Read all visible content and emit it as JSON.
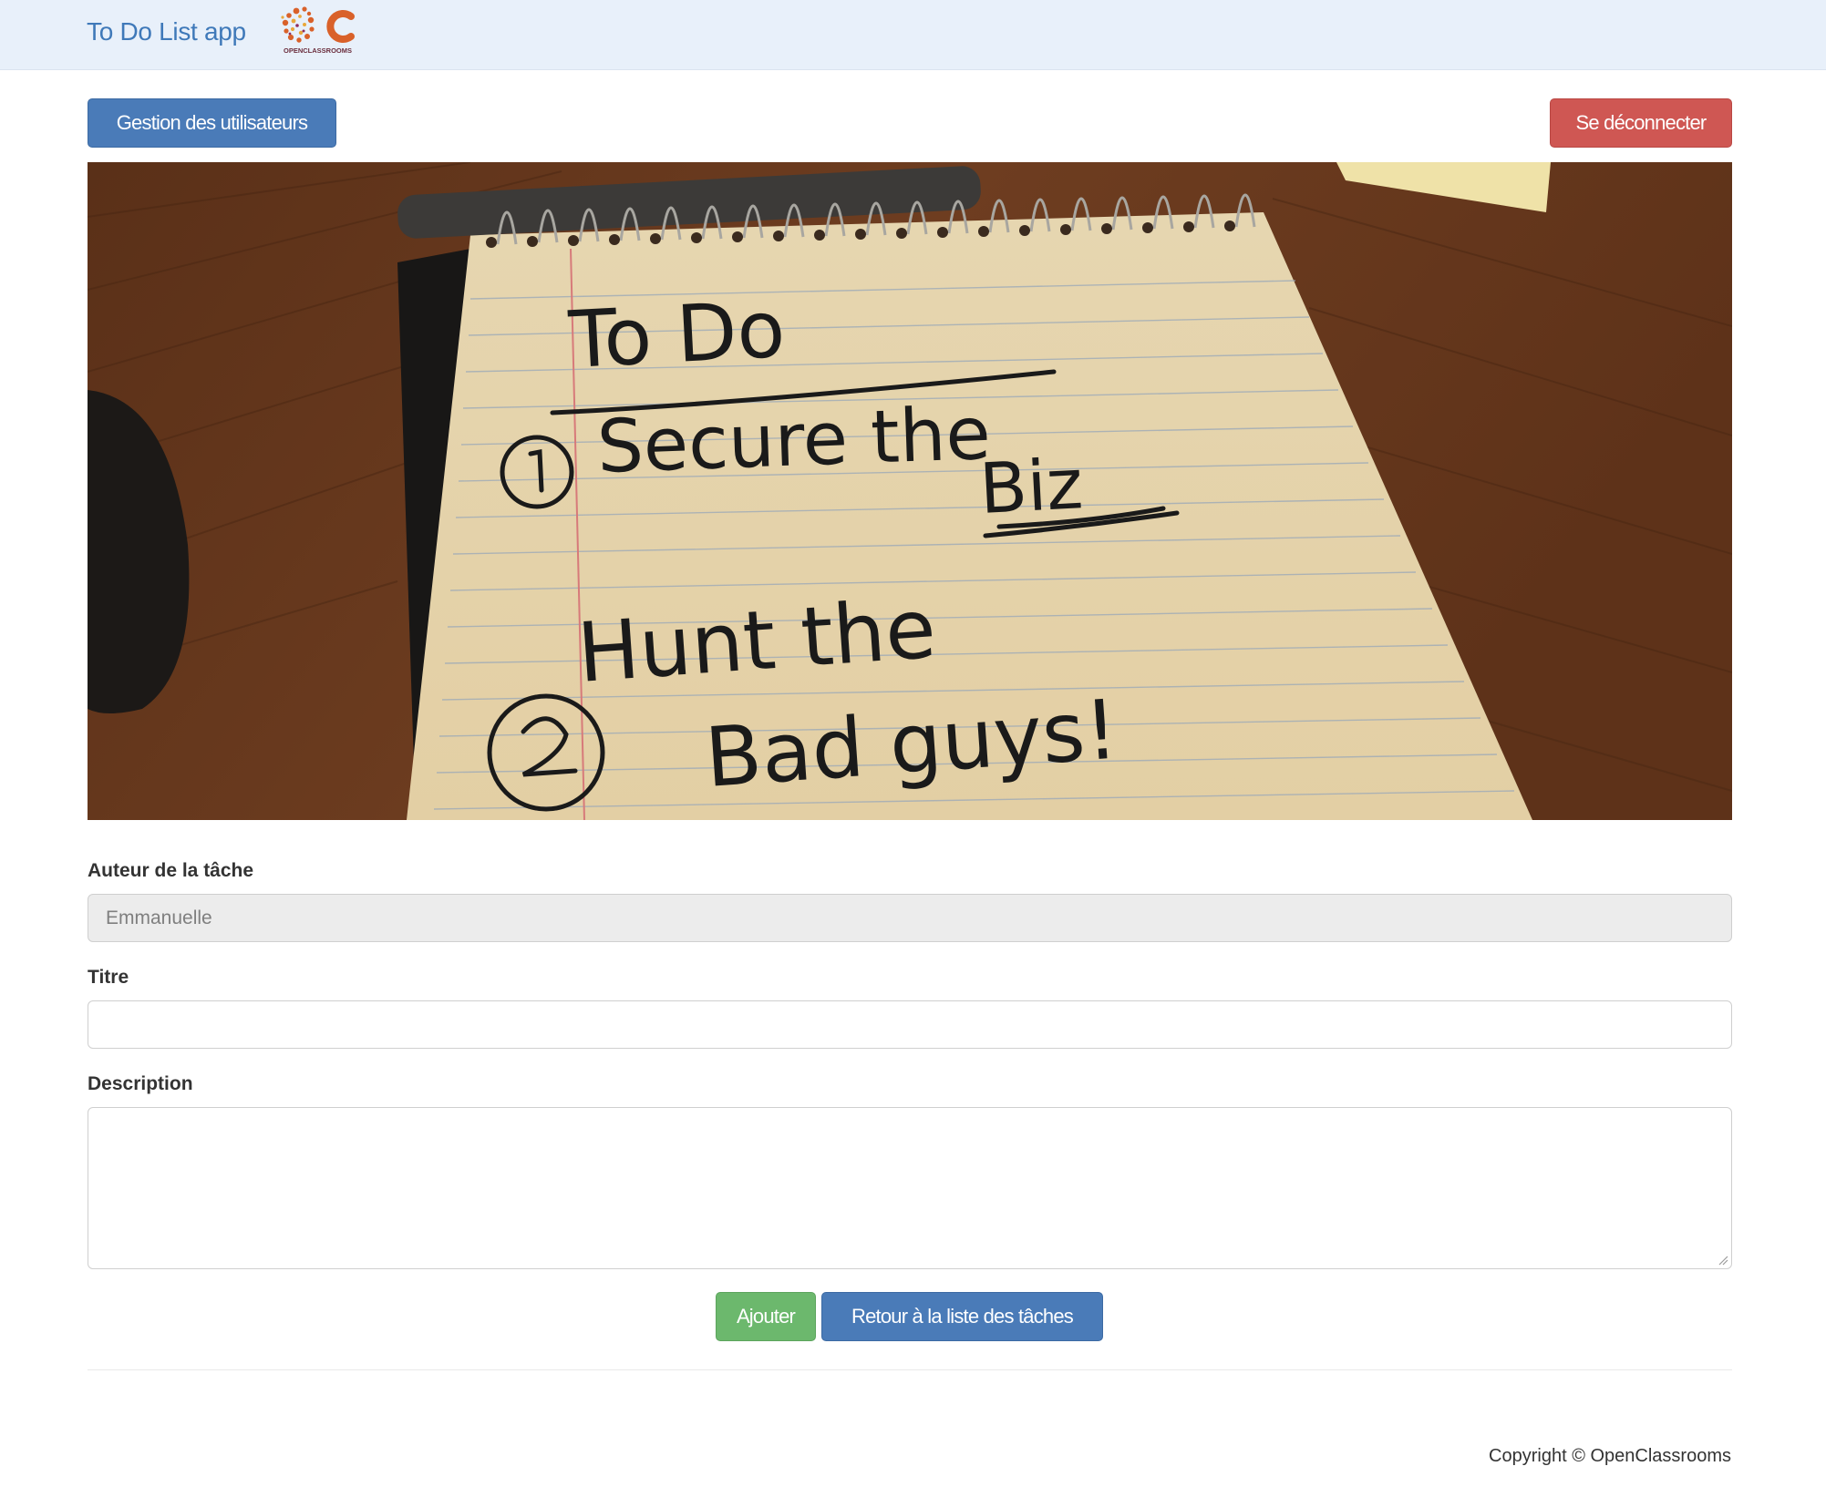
{
  "navbar": {
    "brand": "To Do List app",
    "logo_icon": "openclassrooms-logo",
    "logo_text": "OPENCLASSROOMS"
  },
  "actions": {
    "users_button": "Gestion des utilisateurs",
    "logout_button": "Se déconnecter"
  },
  "hero": {
    "image": "todo-notebook-photo",
    "handwriting": [
      "To Do",
      "Secure the",
      "Biz",
      "Hunt the",
      "Bad guys!"
    ]
  },
  "form": {
    "author_label": "Auteur de la tâche",
    "author_value": "Emmanuelle",
    "title_label": "Titre",
    "title_value": "",
    "description_label": "Description",
    "description_value": "",
    "submit_button": "Ajouter",
    "back_button": "Retour à la liste des tâches"
  },
  "footer": {
    "copyright": "Copyright © OpenClassrooms"
  },
  "colors": {
    "primary": "#4a7bb8",
    "danger": "#cf5753",
    "success": "#6cb86d",
    "navbar_bg": "#e8f0fa",
    "brand": "#3f79b9"
  }
}
